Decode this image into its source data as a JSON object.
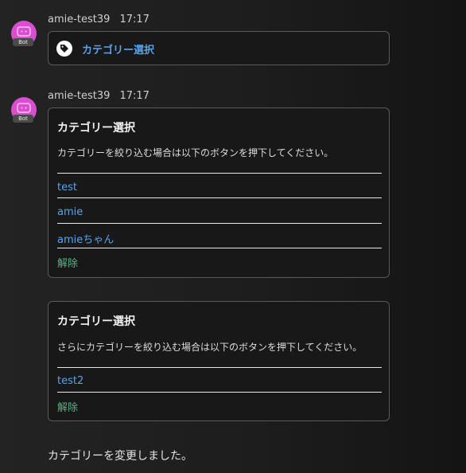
{
  "messages": [
    {
      "author": "amie-test39",
      "time": "17:17",
      "bot_tag": "Bot",
      "link": {
        "label": "カテゴリー選択",
        "icon": "tag-icon"
      }
    },
    {
      "author": "amie-test39",
      "time": "17:17",
      "bot_tag": "Bot",
      "cards": [
        {
          "title": "カテゴリー選択",
          "description": "カテゴリーを絞り込む場合は以下のボタンを押下してください。",
          "options": [
            "test",
            "amie",
            "amieちゃん"
          ],
          "reset_label": "解除"
        },
        {
          "title": "カテゴリー選択",
          "description": "さらにカテゴリーを絞り込む場合は以下のボタンを押下してください。",
          "options": [
            "test2"
          ],
          "reset_label": "解除"
        }
      ]
    }
  ],
  "status_text": "カテゴリーを変更しました。",
  "colors": {
    "avatar": "#d94fcf",
    "link": "#5aa3ea",
    "reset": "#57b38a",
    "card_border": "#5a5a5a"
  }
}
